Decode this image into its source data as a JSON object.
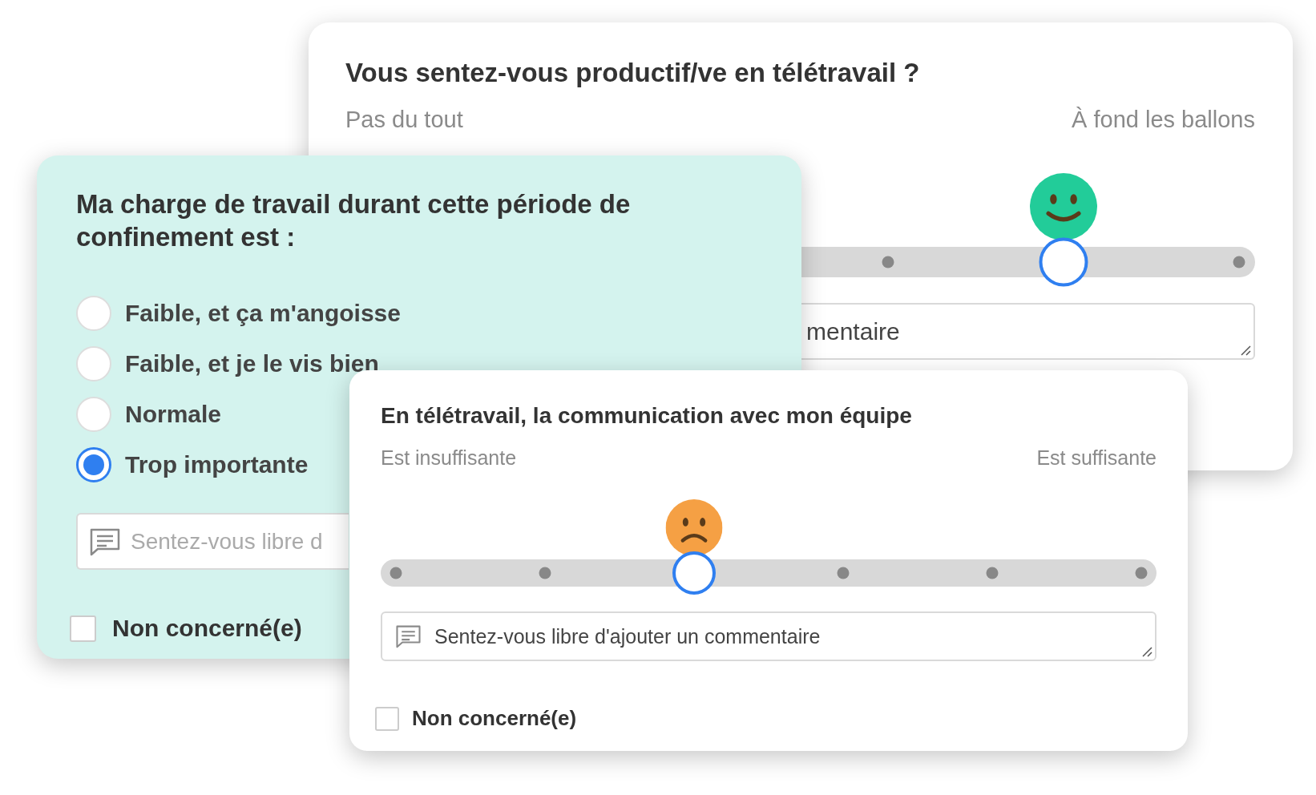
{
  "cards": [
    {
      "kind": "scale",
      "question": "Vous sentez-vous productif/ve en télétravail ?",
      "min_label": "Pas du tout",
      "max_label": "À fond les ballons",
      "level": 0.8,
      "comment": {
        "placeholder": "mentaire"
      }
    },
    {
      "kind": "choice",
      "question": "Ma charge de travail durant cette période de confinement est :",
      "options": [
        {
          "label": "Faible, et ça m'angoisse",
          "selected": false
        },
        {
          "label": "Faible, et je le vis bien",
          "selected": false
        },
        {
          "label": "Normale",
          "selected": false
        },
        {
          "label": "Trop importante",
          "selected": true
        }
      ],
      "comment": {
        "placeholder": "Sentez-vous libre d"
      },
      "not_concerned": {
        "label": "Non concerné(e)",
        "checked": false
      }
    },
    {
      "kind": "scale",
      "question": "En télétravail, la communication avec mon équipe",
      "min_label": "Est insuffisante",
      "max_label": "Est suffisante",
      "level": 0.4,
      "comment": {
        "placeholder": "Sentez-vous libre d'ajouter un commentaire"
      },
      "not_concerned": {
        "label": "Non concerné(e)",
        "checked": false
      }
    }
  ]
}
